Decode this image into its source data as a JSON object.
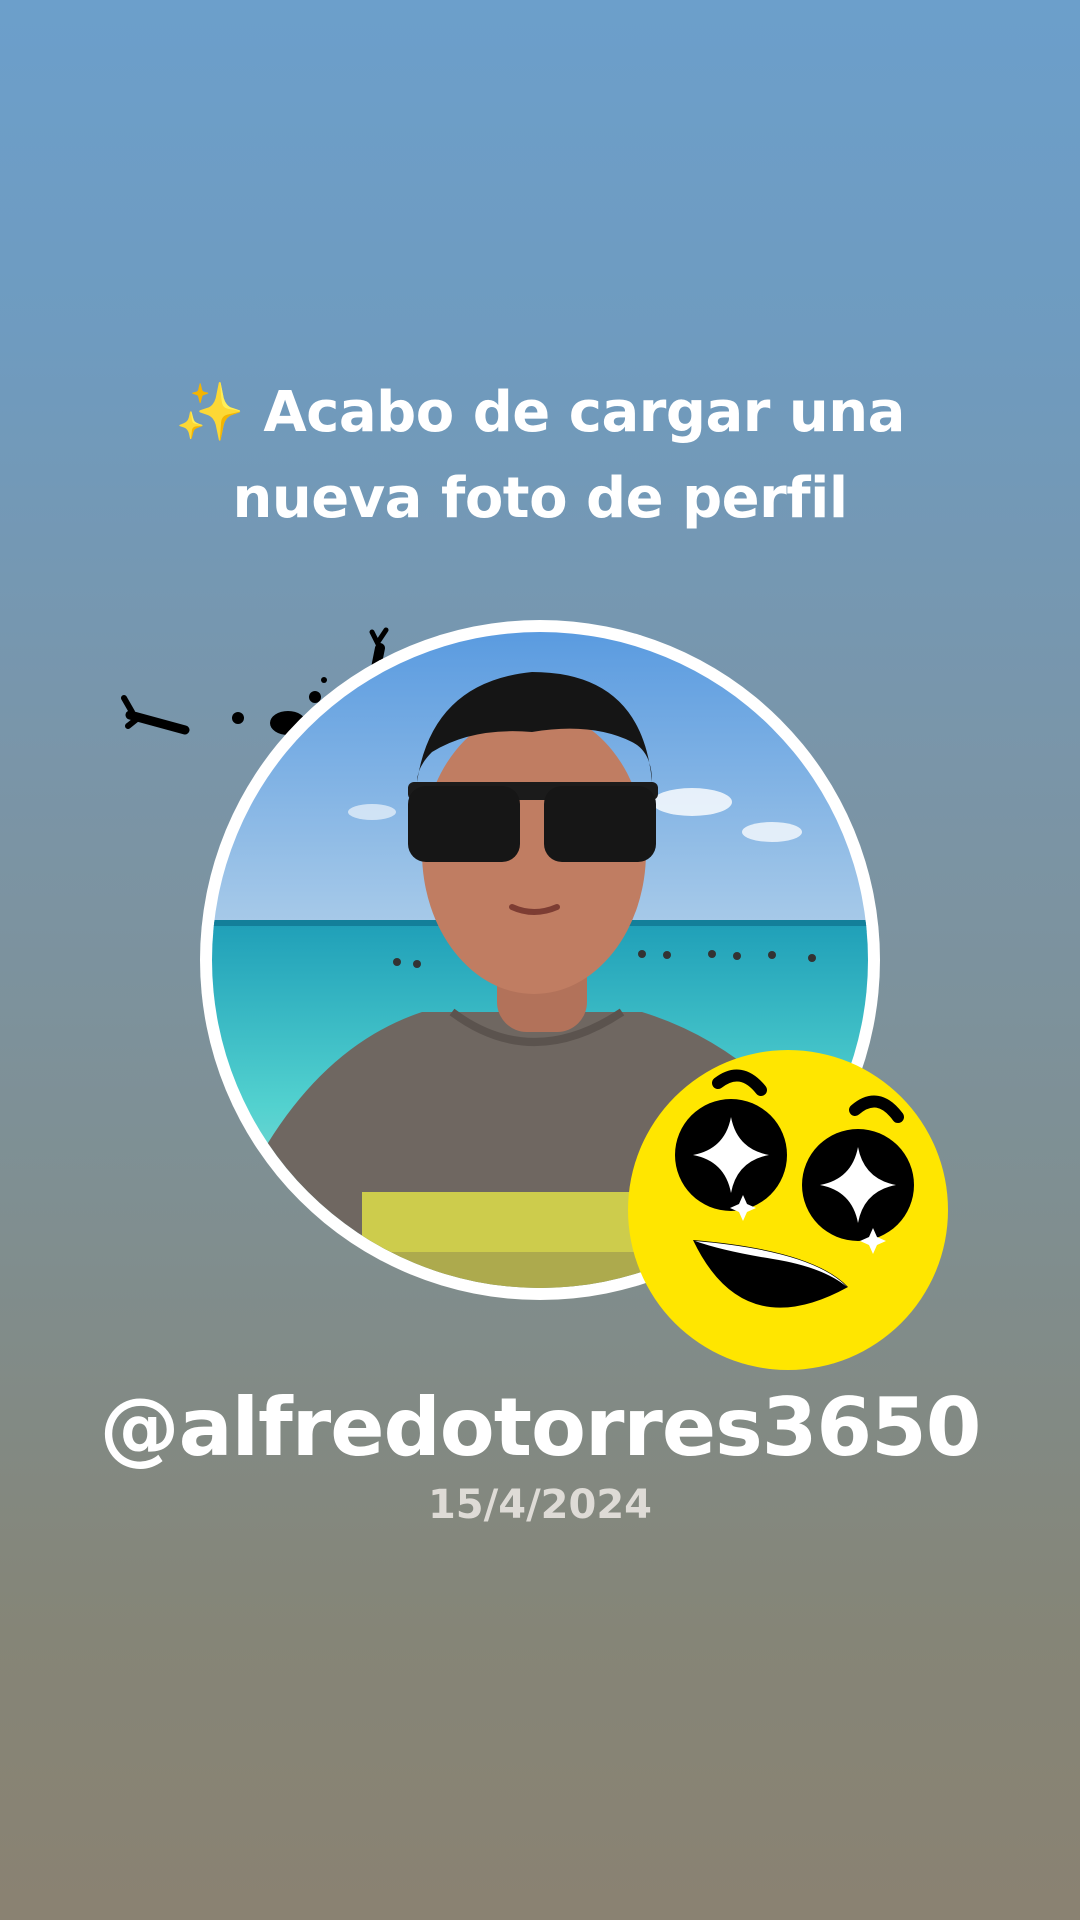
{
  "post": {
    "headline_line1": "✨ Acabo de cargar una",
    "headline_line2": "nueva foto de perfil",
    "username": "@alfredotorres3650",
    "date": "15/4/2024"
  },
  "decorations": {
    "emoji": "star-struck-emoji",
    "doodle": "sparkle-doodle-icon"
  },
  "colors": {
    "text": "#ffffff",
    "date_text": "#dedbd6",
    "avatar_ring": "#ffffff",
    "emoji_face": "#ffe600"
  }
}
